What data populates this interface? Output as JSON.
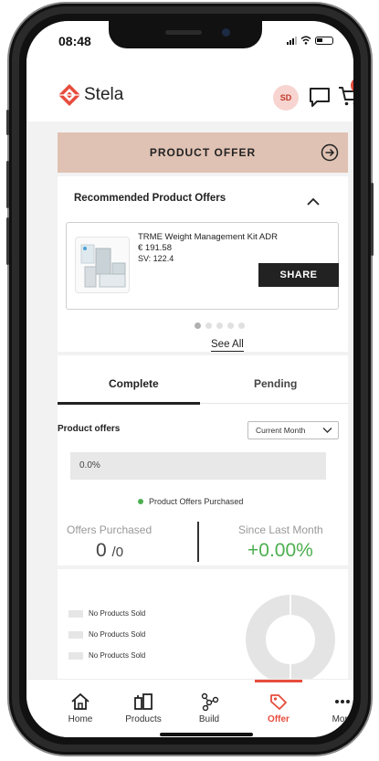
{
  "status_bar": {
    "time": "08:48"
  },
  "header": {
    "brand": "Stela",
    "avatar_initials": "SD",
    "cart_count": "1"
  },
  "offer_bar": {
    "title": "PRODUCT OFFER"
  },
  "recommended": {
    "title": "Recommended Product Offers",
    "product": {
      "name": "TRME Weight Management Kit ADR",
      "price": "€ 191.58",
      "sv": "SV: 122.4"
    },
    "share_label": "SHARE",
    "see_all": "See All",
    "carousel_pages": 5,
    "carousel_active": 0
  },
  "tabs": {
    "complete": "Complete",
    "pending": "Pending",
    "active": "complete"
  },
  "product_offers": {
    "label": "Product offers",
    "period": "Current Month",
    "progress_label": "0.0%",
    "progress_fraction": 0.0,
    "legend": "Product Offers Purchased",
    "offers_purchased_label": "Offers Purchased",
    "offers_purchased_value": "0",
    "offers_purchased_total": "0",
    "since_last_month_label": "Since Last Month",
    "since_last_month_value": "+0.00%"
  },
  "sales_legend": [
    "No Products Sold",
    "No Products Sold",
    "No Products Sold"
  ],
  "nav": {
    "items": [
      {
        "label": "Home"
      },
      {
        "label": "Products"
      },
      {
        "label": "Build"
      },
      {
        "label": "Offer"
      },
      {
        "label": "More"
      }
    ],
    "active_index": 3
  },
  "colors": {
    "accent": "#e74c3c",
    "offer_bar": "#dfc2b3",
    "positive": "#4caf50"
  }
}
